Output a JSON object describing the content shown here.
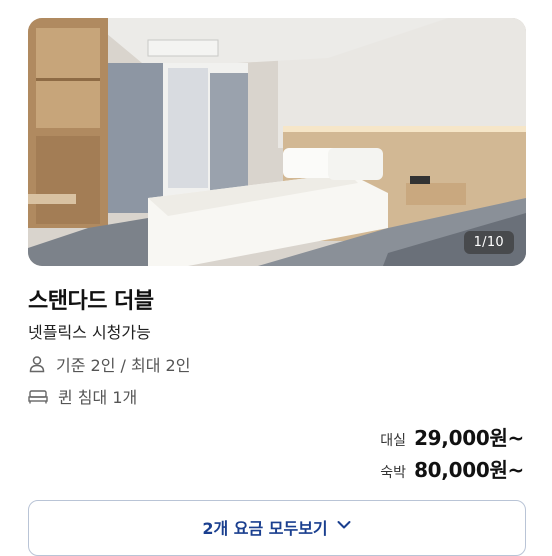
{
  "photo": {
    "alt_subject": "standard double room photo",
    "counter": "1/10"
  },
  "room": {
    "title": "스탠다드 더블",
    "subtitle": "넷플릭스 시청가능",
    "capacity": "기준 2인 / 최대 2인",
    "bed": "퀸 침대 1개"
  },
  "prices": [
    {
      "label": "대실",
      "value": "29,000원~"
    },
    {
      "label": "숙박",
      "value": "80,000원~"
    }
  ],
  "rates_button": {
    "label": "2개 요금 모두보기"
  },
  "colors": {
    "accent": "#1a3f8f",
    "button_border": "#b9c4d6"
  }
}
